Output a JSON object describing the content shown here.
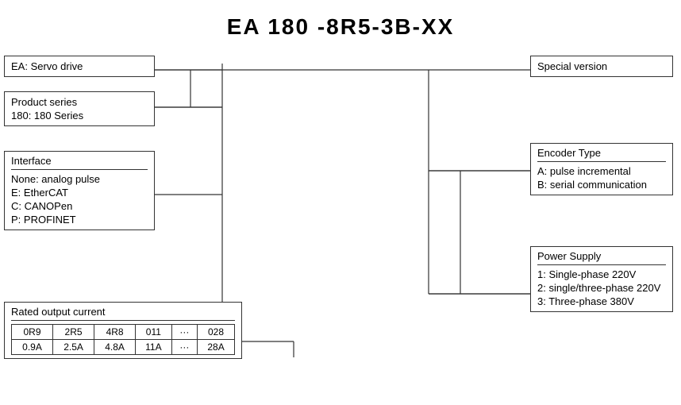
{
  "title": "EA 180 -8R5-3B-XX",
  "boxes": {
    "ea": {
      "line1": "EA: Servo drive"
    },
    "product": {
      "line1": "Product series",
      "line2": "180: 180 Series"
    },
    "interface": {
      "title": "Interface",
      "items": [
        "None: analog pulse",
        "E: EtherCAT",
        "C: CANOPen",
        "P: PROFINET"
      ]
    },
    "rated": {
      "title": "Rated output current",
      "headers": [
        "0R9",
        "2R5",
        "4R8",
        "011",
        "···",
        "028"
      ],
      "values": [
        "0.9A",
        "2.5A",
        "4.8A",
        "11A",
        "···",
        "28A"
      ]
    },
    "special": {
      "title": "Special version"
    },
    "encoder": {
      "title": "Encoder Type",
      "items": [
        "A: pulse incremental",
        "B: serial communication"
      ]
    },
    "power": {
      "title": "Power Supply",
      "items": [
        "1: Single-phase 220V",
        "2: single/three-phase 220V",
        "3: Three-phase 380V"
      ]
    }
  }
}
